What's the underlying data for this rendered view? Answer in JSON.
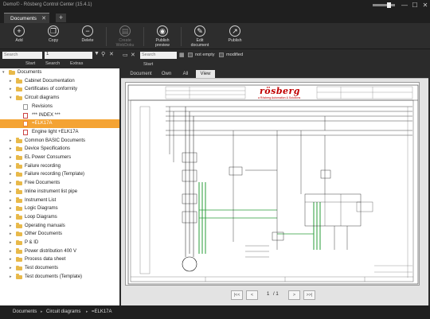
{
  "window": {
    "title": "Demo© - Rösberg Control Center (15.4.1)",
    "minimize": "—",
    "maximize": "☐",
    "close": "✕"
  },
  "doc_tab": {
    "label": "Documents",
    "close": "✕",
    "add": "+"
  },
  "ribbon": {
    "add": "Add",
    "copy": "Copy",
    "delete": "Delete",
    "create_webdoku_1": "Create",
    "create_webdoku_2": "WebDoku",
    "publish_preview_1": "Publish",
    "publish_preview_2": "preview",
    "edit_document_1": "Edit",
    "edit_document_2": "document",
    "publish": "Publish"
  },
  "left": {
    "search_placeholder": "Search",
    "filter_value": "1",
    "tabs": [
      "Start",
      "Search",
      "Extras"
    ]
  },
  "tree": [
    {
      "label": "Documents",
      "level": 0,
      "expand": "▾",
      "type": "folder"
    },
    {
      "label": "Cabinet Documentation",
      "level": 1,
      "expand": "▸",
      "type": "folder"
    },
    {
      "label": "Certificates of conformity",
      "level": 1,
      "expand": "▸",
      "type": "folder"
    },
    {
      "label": "Circuit diagrams",
      "level": 1,
      "expand": "▾",
      "type": "folder"
    },
    {
      "label": "Revisions",
      "level": 2,
      "expand": "",
      "type": "file"
    },
    {
      "label": "*** INDEX ***",
      "level": 2,
      "expand": "",
      "type": "pdf"
    },
    {
      "label": "=ELK17A",
      "level": 2,
      "expand": "",
      "type": "orange",
      "selected": true
    },
    {
      "label": "Engine light +ELK17A",
      "level": 2,
      "expand": "",
      "type": "pdf"
    },
    {
      "label": "Common BASIC Documents",
      "level": 1,
      "expand": "▸",
      "type": "folder"
    },
    {
      "label": "Device Specifications",
      "level": 1,
      "expand": "▸",
      "type": "folder"
    },
    {
      "label": "EL Power Consumers",
      "level": 1,
      "expand": "▸",
      "type": "folder"
    },
    {
      "label": "Failure recording",
      "level": 1,
      "expand": "▸",
      "type": "folder"
    },
    {
      "label": "Failure recording (Template)",
      "level": 1,
      "expand": "▸",
      "type": "folder"
    },
    {
      "label": "Free Documents",
      "level": 1,
      "expand": "▸",
      "type": "folder"
    },
    {
      "label": "Inline instrument list pipe",
      "level": 1,
      "expand": "▸",
      "type": "folder"
    },
    {
      "label": "Instrument List",
      "level": 1,
      "expand": "▸",
      "type": "folder"
    },
    {
      "label": "Logic Diagrams",
      "level": 1,
      "expand": "▸",
      "type": "folder"
    },
    {
      "label": "Loop Diagrams",
      "level": 1,
      "expand": "▸",
      "type": "folder"
    },
    {
      "label": "Operating manuals",
      "level": 1,
      "expand": "▸",
      "type": "folder"
    },
    {
      "label": "Other Documents",
      "level": 1,
      "expand": "▸",
      "type": "folder"
    },
    {
      "label": "P & ID",
      "level": 1,
      "expand": "▸",
      "type": "folder"
    },
    {
      "label": "Power distribution 400 V",
      "level": 1,
      "expand": "▸",
      "type": "folder"
    },
    {
      "label": "Process data sheet",
      "level": 1,
      "expand": "▸",
      "type": "folder"
    },
    {
      "label": "Test documents",
      "level": 1,
      "expand": "▸",
      "type": "folder"
    },
    {
      "label": "Test documents (Template)",
      "level": 1,
      "expand": "▸",
      "type": "folder"
    }
  ],
  "viewer": {
    "search_placeholder": "Search",
    "not_empty": "not empty",
    "modified": "modified",
    "start": "Start",
    "tabs": [
      "Document",
      "Own",
      "All",
      "View"
    ],
    "active_tab": "View",
    "logo": "rösberg",
    "logo_sub": "a Rösberg Automation & Solutions",
    "page_current": "1",
    "page_total": "/ 1",
    "first": "|<<",
    "prev": "<",
    "next": ">",
    "last": ">>|"
  },
  "status": {
    "crumbs": [
      "Documents",
      "Circuit diagrams",
      "=ELK17A"
    ]
  }
}
